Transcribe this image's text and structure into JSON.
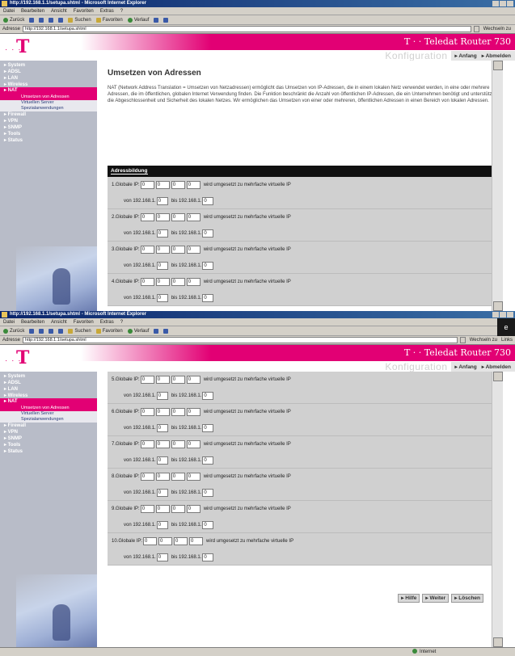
{
  "browser": {
    "title_1": "http://192.168.1.1/setupa.shtml - Microsoft Internet Explorer",
    "title_2": "http://192.168.1.1/setupa.shtml - Microsoft Internet Explorer",
    "menu": [
      "Datei",
      "Bearbeiten",
      "Ansicht",
      "Favoriten",
      "Extras",
      "?"
    ],
    "toolbar": {
      "back": "Zurück",
      "search": "Suchen",
      "favorites": "Favoriten",
      "history": "Verlauf"
    },
    "address_label": "Adresse",
    "url_1": "http://192.168.1.1/setupa.shtml",
    "url_2": "http://192.168.1.1/setupa.shtml",
    "goto_1": "Wechseln zu",
    "goto_2": "Wechseln zu",
    "links": "Links",
    "status_zone": "Internet"
  },
  "header": {
    "dots": "· · ·",
    "logo": "T",
    "product": "T · · Teledat Router 730",
    "konfig": "Konfiguration",
    "nav_start": "▸ Anfang",
    "nav_logout": "▸ Abmelden"
  },
  "sidebar_1": {
    "items": [
      "▸ System",
      "▸ ADSL",
      "▸ LAN",
      "▸ Wireless"
    ],
    "active": "▸ NAT",
    "subs": [
      "Umsetzen von Adressen",
      "Virtuellen Server",
      "Spezialanwendungen"
    ],
    "rest": [
      "▸ Firewall",
      "▸ VPN",
      "▸ SNMP",
      "▸ Tools",
      "▸ Status"
    ]
  },
  "sidebar_2": {
    "items": [
      "▸ System",
      "▸ ADSL",
      "▸ LAN",
      "▸ Wireless"
    ],
    "active": "▸ NAT",
    "subs": [
      "Umsetzen von Adressen",
      "Virtuellen Server",
      "Spezialanwendungen"
    ],
    "rest": [
      "▸ Firewall",
      "▸ VPN",
      "▸ SNMP",
      "▸ Tools",
      "▸ Status"
    ]
  },
  "page": {
    "title": "Umsetzen von Adressen",
    "description": "NAT (Network Address Translation = Umsetzen von Netzadressen) ermöglicht das Umsetzen von IP-Adressen, die in einem lokalen Netz verwendet werden, in eine oder mehrere Adressen, die im öffentlichen, globalen Internet Verwendung finden. Die Funktion beschränkt die Anzahl von öffentlichen IP-Adressen, die ein Unternehmen benötigt und unterstützt die Abgeschlossenheit und Sicherheit des lokalen Netzes. Wir ermöglichen das Umsetzen von einer oder mehreren, öffentlichen Adressen in einen Bereich von lokalen Adressen.",
    "section_header": "Adressbildung",
    "label_global": "Globale IP:",
    "label_mapped": "wird umgesetzt zu mehrfache virtuelle IP",
    "label_from": "von",
    "label_to": "bis",
    "prefix_from": "192.168.1.",
    "prefix_to": "192.168.1.",
    "oct_value": "0",
    "rows_1": [
      {
        "n": "1."
      },
      {
        "n": "2."
      },
      {
        "n": "3."
      },
      {
        "n": "4."
      }
    ],
    "rows_2": [
      {
        "n": "5."
      },
      {
        "n": "6."
      },
      {
        "n": "7."
      },
      {
        "n": "8."
      },
      {
        "n": "9."
      },
      {
        "n": "10."
      }
    ],
    "btn_help": "▸ Hilfe",
    "btn_next": "▸ Weiter",
    "btn_delete": "▸ Löschen"
  }
}
